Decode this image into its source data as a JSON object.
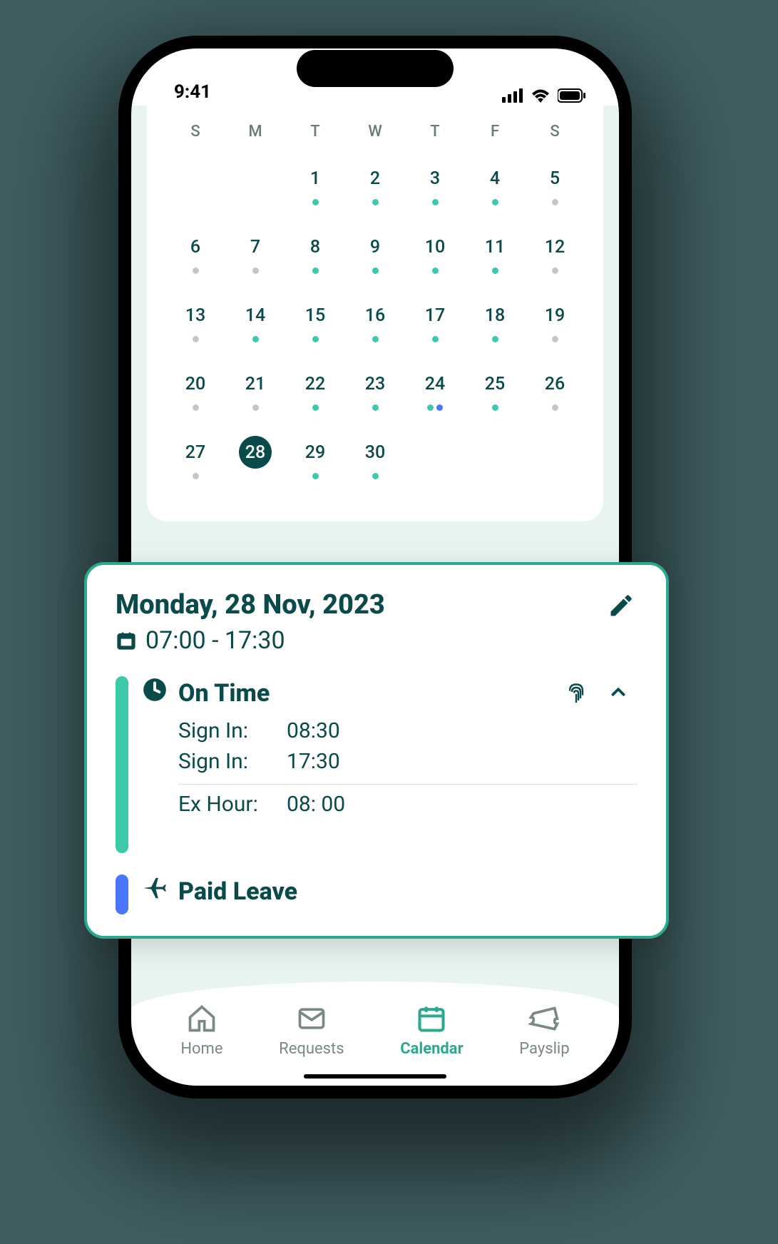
{
  "status": {
    "time": "9:41"
  },
  "calendar": {
    "dow": [
      "S",
      "M",
      "T",
      "W",
      "T",
      "F",
      "S"
    ],
    "weeks": [
      [
        null,
        null,
        {
          "n": "1",
          "dots": [
            "teal"
          ]
        },
        {
          "n": "2",
          "dots": [
            "teal"
          ]
        },
        {
          "n": "3",
          "dots": [
            "teal"
          ]
        },
        {
          "n": "4",
          "dots": [
            "teal"
          ]
        },
        {
          "n": "5",
          "dots": [
            "gray"
          ]
        }
      ],
      [
        {
          "n": "6",
          "dots": [
            "gray"
          ]
        },
        {
          "n": "7",
          "dots": [
            "gray"
          ]
        },
        {
          "n": "8",
          "dots": [
            "teal"
          ]
        },
        {
          "n": "9",
          "dots": [
            "teal"
          ]
        },
        {
          "n": "10",
          "dots": [
            "teal"
          ]
        },
        {
          "n": "11",
          "dots": [
            "teal"
          ]
        },
        {
          "n": "12",
          "dots": [
            "gray"
          ]
        }
      ],
      [
        {
          "n": "13",
          "dots": [
            "gray"
          ]
        },
        {
          "n": "14",
          "dots": [
            "teal"
          ]
        },
        {
          "n": "15",
          "dots": [
            "teal"
          ]
        },
        {
          "n": "16",
          "dots": [
            "teal"
          ]
        },
        {
          "n": "17",
          "dots": [
            "teal"
          ]
        },
        {
          "n": "18",
          "dots": [
            "teal"
          ]
        },
        {
          "n": "19",
          "dots": [
            "gray"
          ]
        }
      ],
      [
        {
          "n": "20",
          "dots": [
            "gray"
          ]
        },
        {
          "n": "21",
          "dots": [
            "gray"
          ]
        },
        {
          "n": "22",
          "dots": [
            "teal"
          ]
        },
        {
          "n": "23",
          "dots": [
            "teal"
          ]
        },
        {
          "n": "24",
          "dots": [
            "teal",
            "blue"
          ]
        },
        {
          "n": "25",
          "dots": [
            "teal"
          ]
        },
        {
          "n": "26",
          "dots": [
            "gray"
          ]
        }
      ],
      [
        {
          "n": "27",
          "dots": [
            "gray"
          ]
        },
        {
          "n": "28",
          "dots": [],
          "selected": true
        },
        {
          "n": "29",
          "dots": [
            "teal"
          ]
        },
        {
          "n": "30",
          "dots": [
            "teal"
          ]
        },
        null,
        null,
        null
      ]
    ]
  },
  "detail": {
    "title": "Monday, 28 Nov, 2023",
    "timeRange": "07:00 - 17:30",
    "entries": [
      {
        "color": "teal",
        "icon": "clock",
        "title": "On Time",
        "expandable": true,
        "rows": [
          {
            "label": "Sign In:",
            "value": "08:30"
          },
          {
            "label": "Sign In:",
            "value": "17:30"
          }
        ],
        "extra": {
          "label": "Ex Hour:",
          "value": "08: 00"
        }
      },
      {
        "color": "blue",
        "icon": "plane",
        "title": "Paid Leave"
      }
    ]
  },
  "nav": {
    "items": [
      {
        "label": "Home",
        "icon": "home"
      },
      {
        "label": "Requests",
        "icon": "mail"
      },
      {
        "label": "Calendar",
        "icon": "calendar",
        "active": true
      },
      {
        "label": "Payslip",
        "icon": "ticket"
      }
    ]
  }
}
